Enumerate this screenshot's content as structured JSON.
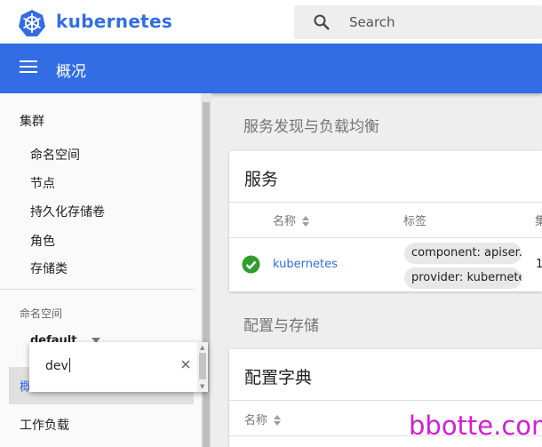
{
  "header": {
    "brand": "kubernetes",
    "search_placeholder": "Search",
    "page_title": "概况"
  },
  "sidebar": {
    "cluster_label": "集群",
    "cluster_items": [
      "命名空间",
      "节点",
      "持久化存储卷",
      "角色",
      "存储类"
    ],
    "namespace_label": "命名空间",
    "namespace_value": "default",
    "active_item": "概",
    "workload_label": "工作负载"
  },
  "namespace_dropdown": {
    "input_value": "dev"
  },
  "main": {
    "discovery_section": "服务发现与负载均衡",
    "services_card": {
      "title": "服务",
      "columns": [
        "名称",
        "标签",
        "集"
      ],
      "rows": [
        {
          "status": "ok",
          "name": "kubernetes",
          "labels": [
            "component: apiser...",
            "provider: kubernetes"
          ],
          "cluster_ip": "1"
        }
      ]
    },
    "config_section": "配置与存储",
    "configmaps_card": {
      "title": "配置字典",
      "columns": [
        "名称"
      ]
    }
  },
  "watermark": "bbotte.com",
  "colors": {
    "brand_blue": "#326de6",
    "status_green": "#2e9e2e",
    "watermark": "#d21ed2"
  }
}
